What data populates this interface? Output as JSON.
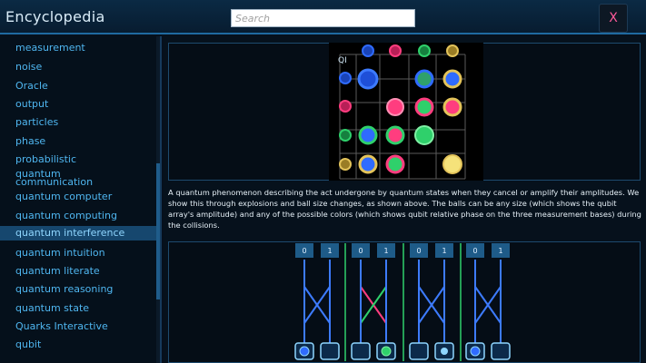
{
  "app": {
    "title": "Encyclopedia"
  },
  "search": {
    "placeholder": "Search"
  },
  "close": {
    "label": "X"
  },
  "sidebar": {
    "items": [
      {
        "label": "measurement"
      },
      {
        "label": "noise"
      },
      {
        "label": "Oracle"
      },
      {
        "label": "output"
      },
      {
        "label": "particles"
      },
      {
        "label": "phase"
      },
      {
        "label": "probabilistic"
      },
      {
        "label": "quantum\ncommunication"
      },
      {
        "label": "quantum computer"
      },
      {
        "label": "quantum computing"
      },
      {
        "label": "quantum interference",
        "selected": true
      },
      {
        "label": "quantum intuition"
      },
      {
        "label": "quantum literate"
      },
      {
        "label": "quantum reasoning"
      },
      {
        "label": "quantum state"
      },
      {
        "label": "Quarks Interactive"
      },
      {
        "label": "qubit"
      }
    ]
  },
  "figure": {
    "grid_label": "QI",
    "colors": {
      "blue": "#2f6bff",
      "pink": "#ff3d7f",
      "green": "#2fd06b",
      "gold": "#e3c35a",
      "cyan": "#55d6ff"
    }
  },
  "description": "A quantum phenomenon describing the act undergone by quantum states when they cancel or amplify their amplitudes. We show this through explosions and ball size changes, as shown above. The balls can be any size (which shows the qubit array's amplitude) and any of the possible colors (which shows qubit relative phase on the three measurement bases) during the collisions.",
  "circuit": {
    "labels": [
      "0",
      "1",
      "0",
      "1",
      "0",
      "1",
      "0",
      "1"
    ]
  }
}
